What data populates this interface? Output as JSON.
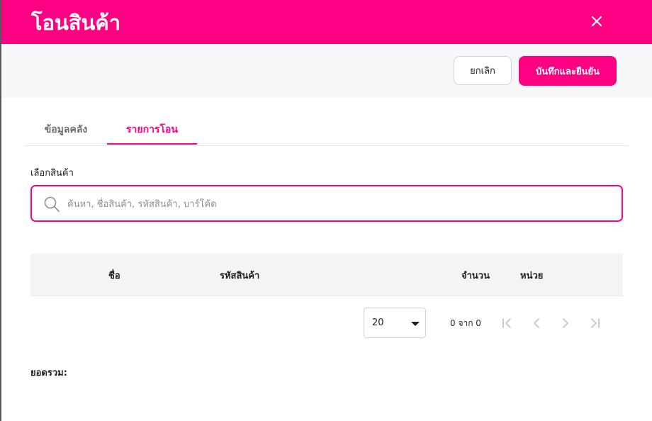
{
  "modal": {
    "title": "โอนสินค้า",
    "close_icon": "close-icon"
  },
  "toolbar": {
    "cancel_label": "ยกเลิก",
    "save_label": "บันทึกและยืนยัน"
  },
  "tabs": [
    {
      "label": "ข้อมูลคลัง",
      "active": false
    },
    {
      "label": "รายการโอน",
      "active": true
    }
  ],
  "product_select": {
    "label": "เลือกสินค้า",
    "placeholder": "ค้นหา, ชื่อสินค้า, รหัสสินค้า, บาร์โค้ด",
    "value": "",
    "icon": "search-icon"
  },
  "table": {
    "columns": [
      "ชื่อ",
      "รหัสสินค้า",
      "จำนวน",
      "หน่วย"
    ],
    "rows": []
  },
  "pagination": {
    "page_size": "20",
    "count_text": "0 จาก 0",
    "icons": [
      "first-page-icon",
      "previous-page-icon",
      "next-page-icon",
      "last-page-icon"
    ]
  },
  "summary": {
    "total_label": "ยอดรวม:"
  },
  "colors": {
    "brand": "#fe0082",
    "toolbar_bg": "#f6f7f9",
    "table_header_bg": "#f3f4f6"
  }
}
